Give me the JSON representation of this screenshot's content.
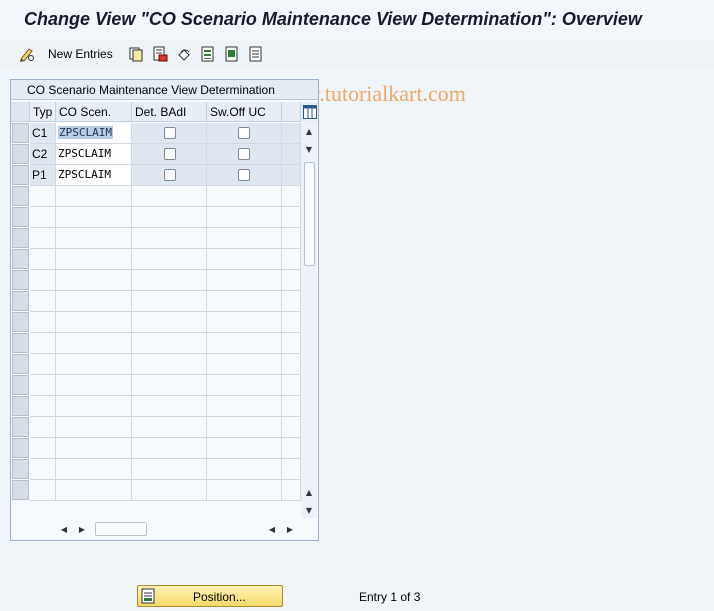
{
  "header": {
    "title": "Change View \"CO Scenario Maintenance View Determination\": Overview"
  },
  "toolbar": {
    "new_entries_label": "New Entries",
    "watermark": "www.tutorialkart.com"
  },
  "table": {
    "title": "CO Scenario Maintenance View Determination",
    "columns": [
      "Typ",
      "CO Scen.",
      "Det. BAdI",
      "Sw.Off UC"
    ],
    "rows": [
      {
        "typ": "C1",
        "scenario": "ZPSCLAIM",
        "det_badi": false,
        "sw_off_uc": false
      },
      {
        "typ": "C2",
        "scenario": "ZPSCLAIM",
        "det_badi": false,
        "sw_off_uc": false
      },
      {
        "typ": "P1",
        "scenario": "ZPSCLAIM",
        "det_badi": false,
        "sw_off_uc": false
      }
    ]
  },
  "footer": {
    "position_label": "Position...",
    "entry_info": "Entry 1 of 3"
  }
}
